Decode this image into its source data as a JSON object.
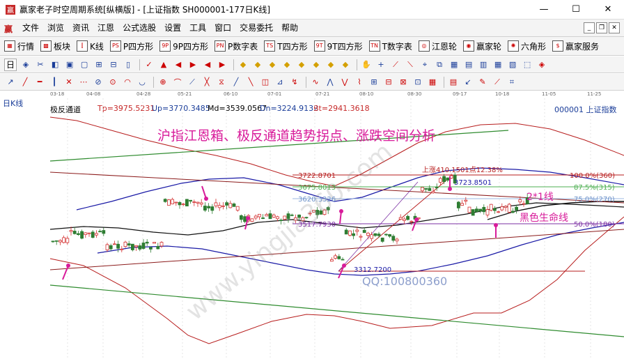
{
  "window": {
    "title": "赢家老子时空周期系统[纵横版] - [上证指数  SH000001-177日K线]",
    "buttons": [
      "—",
      "☐",
      "✕"
    ]
  },
  "menu": {
    "items": [
      "文件",
      "浏览",
      "资讯",
      "江恩",
      "公式选股",
      "设置",
      "工具",
      "窗口",
      "交易委托",
      "帮助"
    ],
    "mdi_buttons": [
      "_",
      "❐",
      "✕"
    ]
  },
  "toolbar1": {
    "items": [
      {
        "icon": "grid-icon",
        "glyph": "▦",
        "label": "行情"
      },
      {
        "icon": "sector-icon",
        "glyph": "▩",
        "label": "板块"
      },
      {
        "icon": "kline-icon",
        "glyph": "⫿",
        "label": "K线"
      },
      {
        "icon": "ps-icon",
        "glyph": "PS",
        "label": "P四方形"
      },
      {
        "icon": "9p-icon",
        "glyph": "9P",
        "label": "9P四方形"
      },
      {
        "icon": "pn-icon",
        "glyph": "PN",
        "label": "P数字表"
      },
      {
        "icon": "ts-icon",
        "glyph": "TS",
        "label": "T四方形"
      },
      {
        "icon": "9t-icon",
        "glyph": "9T",
        "label": "9T四方形"
      },
      {
        "icon": "tn-icon",
        "glyph": "TN",
        "label": "T数字表"
      },
      {
        "icon": "gann-wheel-icon",
        "glyph": "◎",
        "label": "江恩轮"
      },
      {
        "icon": "winner-wheel-icon",
        "glyph": "◉",
        "label": "赢家轮"
      },
      {
        "icon": "hexagon-icon",
        "glyph": "✺",
        "label": "六角形"
      },
      {
        "icon": "service-icon",
        "glyph": "$",
        "label": "赢家服务"
      }
    ]
  },
  "toolbar2": {
    "period": "日",
    "buttons": [
      "◈",
      "✂",
      "◧",
      "▣",
      "▢",
      "⊞",
      "⊟",
      "▯",
      "✓",
      "▲",
      "◀",
      "▶",
      "◀",
      "▶",
      "◆",
      "◆",
      "◆",
      "◆",
      "◆",
      "◆",
      "◆",
      "◆",
      "✋",
      "+",
      "⟋",
      "⟍",
      "⌖",
      "⧉",
      "▦",
      "▤",
      "▥",
      "▦",
      "▧",
      "⬚",
      "◈"
    ]
  },
  "toolbar3": {
    "buttons": [
      "↗",
      "╱",
      "━",
      "┃",
      "✕",
      "⋯",
      "⊘",
      "⊙",
      "◠",
      "◡",
      "⊕",
      "⌒",
      "⟋",
      "╳",
      "⧖",
      "╱",
      "╲",
      "◫",
      "⊿",
      "↯",
      "∿",
      "⋀",
      "⋁",
      "⌇",
      "⊞",
      "⊟",
      "⊠",
      "⊡",
      "▦",
      "▤",
      "↙",
      "✎",
      "⟋",
      "⌗"
    ]
  },
  "chart": {
    "period_label": "日K线",
    "dates": [
      "03-18",
      "04-08",
      "04-28",
      "05-21",
      "06-10",
      "07-01",
      "07-21",
      "08-10",
      "08-30",
      "09-17",
      "10-18",
      "11-05",
      "11-25"
    ],
    "indicator": {
      "name": "极反通道",
      "tp": "Tp=3975.5231",
      "up": "Up=3770.3485",
      "md": "Md=3539.0567",
      "dn": "Dn=3224.9132",
      "bt": "Bt=2941.3618"
    },
    "code": "000001 上证指数",
    "headline": "沪指江恩箱、极反通道趋势拐点、涨跌空间分析",
    "watermark": "www.yingjia360.com",
    "watermark2": "QQ:100800360",
    "levels": [
      "3722.8701",
      "3675.8013",
      "3620.3326",
      "3517.7930"
    ],
    "low_label": "3312.7200",
    "high_label": "3723.8501",
    "rise_label": "上涨410.1501点12.38%",
    "pct_labels": [
      "100.0%(360)",
      "87.5%(315)",
      "75.0%(270)",
      "50.0%(180)"
    ],
    "line_label": "2*1线",
    "life_line": "黑色生命线",
    "colors": {
      "channel_red": "#b71c1c",
      "channel_blue": "#1a1aa6",
      "green": "#2e8b2e",
      "magenta": "#d81b9a",
      "up": "#d32f2f",
      "down": "#2e7d32"
    }
  }
}
